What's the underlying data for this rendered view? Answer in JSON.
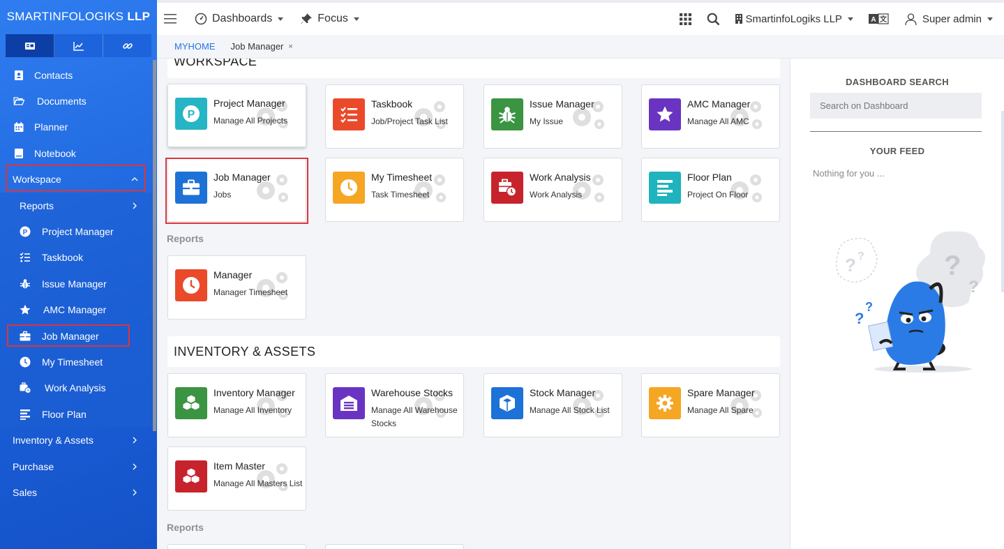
{
  "brand": {
    "name_light": "SMARTINFOLOGIKS",
    "name_bold": "LLP"
  },
  "sidebar": {
    "tabs": [
      {
        "icon": "id-card-icon",
        "active": true
      },
      {
        "icon": "chart-line-icon",
        "active": false
      },
      {
        "icon": "link-icon",
        "active": false
      }
    ],
    "items": [
      {
        "label": "Contacts",
        "icon": "address-book-icon"
      },
      {
        "label": "Documents",
        "icon": "folder-open-icon"
      },
      {
        "label": "Planner",
        "icon": "calendar-icon"
      },
      {
        "label": "Notebook",
        "icon": "notebook-icon"
      },
      {
        "label": "Workspace",
        "expanded": true
      },
      {
        "label": "Reports"
      },
      {
        "label": "Project Manager",
        "icon": "project-p-icon"
      },
      {
        "label": "Taskbook",
        "icon": "checklist-icon"
      },
      {
        "label": "Issue Manager",
        "icon": "bug-icon"
      },
      {
        "label": "AMC Manager",
        "icon": "star-icon"
      },
      {
        "label": "Job Manager",
        "icon": "briefcase-icon",
        "selected": true
      },
      {
        "label": "My Timesheet",
        "icon": "clock-icon"
      },
      {
        "label": "Work Analysis",
        "icon": "briefcase-clock-icon"
      },
      {
        "label": "Floor Plan",
        "icon": "align-left-icon"
      },
      {
        "label": "Inventory & Assets"
      },
      {
        "label": "Purchase"
      },
      {
        "label": "Sales"
      }
    ]
  },
  "topbar": {
    "dashboards": "Dashboards",
    "focus": "Focus",
    "company": "SmartinfoLogiks LLP",
    "user": "Super admin"
  },
  "breadcrumb": {
    "home": "MYHOME",
    "tab": "Job Manager",
    "close": "×"
  },
  "main": {
    "workspace": {
      "title": "WORKSPACE",
      "cards": [
        {
          "title": "Project Manager",
          "subtitle": "Manage All Projects",
          "color": "#26b5c4",
          "icon": "project-p-icon"
        },
        {
          "title": "Taskbook",
          "subtitle": "Job/Project Task List",
          "color": "#ea4a2a",
          "icon": "checklist-icon"
        },
        {
          "title": "Issue Manager",
          "subtitle": "My Issue",
          "color": "#3a9441",
          "icon": "bug-icon"
        },
        {
          "title": "AMC Manager",
          "subtitle": "Manage All AMC",
          "color": "#6a34c2",
          "icon": "star-icon"
        },
        {
          "title": "Job Manager",
          "subtitle": "Jobs",
          "color": "#1c72d6",
          "icon": "briefcase-icon"
        },
        {
          "title": "My Timesheet",
          "subtitle": "Task Timesheet",
          "color": "#f5a623",
          "icon": "clock-icon"
        },
        {
          "title": "Work Analysis",
          "subtitle": "Work Analysis",
          "color": "#c7232c",
          "icon": "briefcase-clock-icon"
        },
        {
          "title": "Floor Plan",
          "subtitle": "Project On Floor",
          "color": "#1eb3bd",
          "icon": "align-left-icon"
        }
      ],
      "reports_label": "Reports",
      "reports": [
        {
          "title": "Manager",
          "subtitle": "Manager Timesheet",
          "color": "#ea4a2a",
          "icon": "clock-icon"
        }
      ]
    },
    "inventory": {
      "title": "INVENTORY & ASSETS",
      "cards": [
        {
          "title": "Inventory Manager",
          "subtitle": "Manage All Inventory",
          "color": "#3a9441",
          "icon": "cubes-icon"
        },
        {
          "title": "Warehouse Stocks",
          "subtitle": "Manage All Warehouse Stocks",
          "color": "#6a34c2",
          "icon": "warehouse-icon"
        },
        {
          "title": "Stock Manager",
          "subtitle": "Manage All Stock List",
          "color": "#1c72d6",
          "icon": "box-icon"
        },
        {
          "title": "Spare Manager",
          "subtitle": "Manage All Spare",
          "color": "#f5a623",
          "icon": "gear-icon"
        },
        {
          "title": "Item Master",
          "subtitle": "Manage All Masters List",
          "color": "#c7232c",
          "icon": "cubes-icon"
        }
      ],
      "reports_label": "Reports"
    }
  },
  "right_panel": {
    "search_title": "DASHBOARD SEARCH",
    "search_placeholder": "Search on Dashboard",
    "feed_title": "YOUR FEED",
    "feed_empty": "Nothing for you ..."
  }
}
